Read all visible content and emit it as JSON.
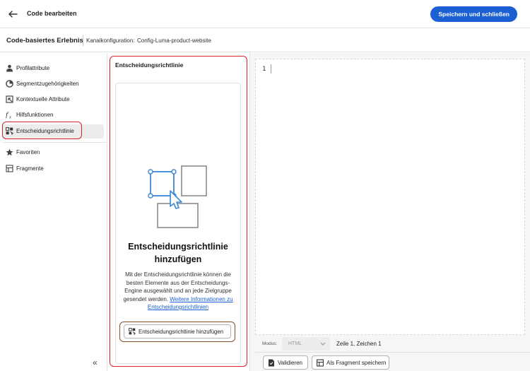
{
  "header": {
    "title": "Code bearbeiten",
    "save_label": "Speichern und schließen"
  },
  "subheader": {
    "experience_title": "Code-basiertes Erlebnis",
    "channel_label": "Kanalkonfiguration:",
    "channel_value": "Config-Luma-product-website"
  },
  "sidebar": {
    "items": [
      {
        "label": "Profilattribute",
        "icon": "person-icon"
      },
      {
        "label": "Segmentzugehörigkeiten",
        "icon": "segment-icon"
      },
      {
        "label": "Kontextuelle Attribute",
        "icon": "context-icon"
      },
      {
        "label": "Hilfsfunktionen",
        "icon": "function-icon"
      },
      {
        "label": "Entscheidungsrichtlinie",
        "icon": "decision-icon",
        "selected": true
      },
      {
        "label": "Favoriten",
        "icon": "star-icon"
      },
      {
        "label": "Fragmente",
        "icon": "fragment-icon"
      }
    ],
    "collapse_glyph": "«"
  },
  "panel": {
    "title": "Entscheidungsrichtlinie",
    "heading": "Entscheidungsrichtlinie hinzufügen",
    "body_text": "Mit der Entscheidungsrichtlinie können die besten Elemente aus der Entscheidungs-Engine ausgewählt und an jede Zielgruppe gesendet werden.",
    "link_text": "Weitere Informationen zu Entscheidungsrichtlinien",
    "add_button": "Entscheidungsrichtlinie hinzufügen"
  },
  "editor": {
    "line_number": "1",
    "mode_label": "Modus:",
    "mode_value": "HTML",
    "position": "Zeile 1, Zeichen 1",
    "validate_button": "Validieren",
    "save_fragment_button": "Als Fragment speichern"
  },
  "colors": {
    "primary": "#1a5fd3",
    "highlight": "#d9232a",
    "accent": "#3a86d8"
  }
}
